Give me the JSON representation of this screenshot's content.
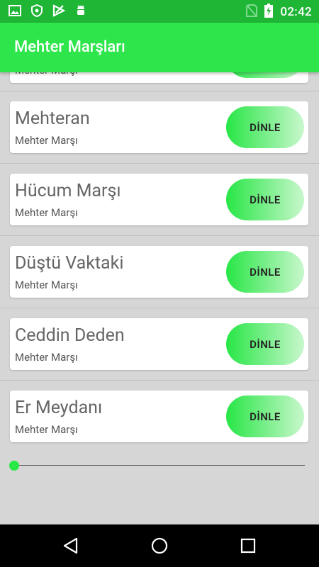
{
  "status_bar": {
    "time": "02:42",
    "left_icons": [
      "image-icon",
      "shield-icon",
      "play-store-icon",
      "android-debug-icon"
    ],
    "right_icons": [
      "no-sim-icon",
      "battery-charging-icon"
    ]
  },
  "toolbar": {
    "title": "Mehter Marşları",
    "color": "#2ee64b"
  },
  "partial_item": {
    "subtitle": "Mehter Marşı"
  },
  "items": [
    {
      "title": "Mehteran",
      "subtitle": "Mehter Marşı",
      "button": "DİNLE"
    },
    {
      "title": "Hücum Marşı",
      "subtitle": "Mehter Marşı",
      "button": "DİNLE"
    },
    {
      "title": "Düştü Vaktaki",
      "subtitle": "Mehter Marşı",
      "button": "DİNLE"
    },
    {
      "title": "Ceddin Deden",
      "subtitle": "Mehter Marşı",
      "button": "DİNLE"
    },
    {
      "title": "Er Meydanı",
      "subtitle": "Mehter Marşı",
      "button": "DİNLE"
    }
  ],
  "player": {
    "progress": 0
  },
  "nav_bar": {
    "buttons": [
      "back-icon",
      "home-icon",
      "recents-icon"
    ]
  }
}
